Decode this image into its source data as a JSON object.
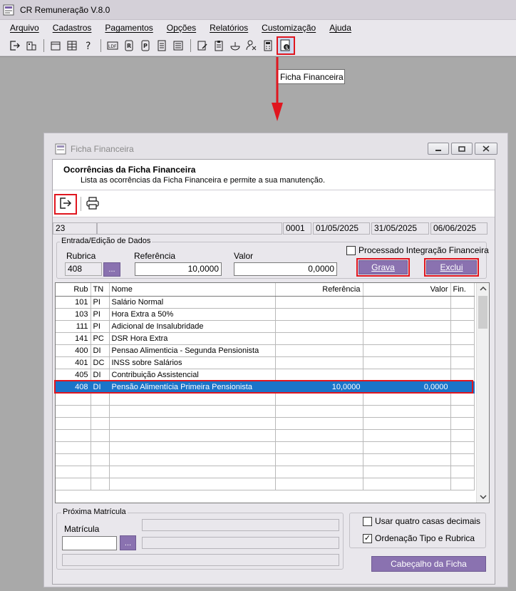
{
  "app": {
    "title": "CR Remuneração V.8.0"
  },
  "menu": [
    {
      "label": "Arquivo"
    },
    {
      "label": "Cadastros"
    },
    {
      "label": "Pagamentos"
    },
    {
      "label": "Opções"
    },
    {
      "label": "Relatórios"
    },
    {
      "label": "Customização"
    },
    {
      "label": "Ajuda"
    }
  ],
  "tooltip": "Ficha Financeira",
  "child": {
    "title": "Ficha Financeira",
    "header_title": "Ocorrências da Ficha Financeira",
    "header_desc": "Lista as ocorrências da Ficha Financeira e permite a sua manutenção."
  },
  "info": {
    "code": "23",
    "name": "",
    "seq": "0001",
    "date_start": "01/05/2025",
    "date_end": "31/05/2025",
    "date_pay": "06/06/2025"
  },
  "entry": {
    "group_label": "Entrada/Edição de Dados",
    "rubrica_label": "Rubrica",
    "rubrica_value": "408",
    "referencia_label": "Referência",
    "referencia_value": "10,0000",
    "valor_label": "Valor",
    "valor_value": "0,0000",
    "processado_label": "Processado Integração Financeira",
    "grava_label": "Grava",
    "exclui_label": "Exclui",
    "lookup_label": "..."
  },
  "grid": {
    "headers": {
      "rub": "Rub",
      "tn": "TN",
      "nome": "Nome",
      "referencia": "Referência",
      "valor": "Valor",
      "fin": "Fin."
    },
    "rows": [
      {
        "rub": "101",
        "tn": "PI",
        "nome": "Salário Normal",
        "referencia": "",
        "valor": "",
        "fin": ""
      },
      {
        "rub": "103",
        "tn": "PI",
        "nome": "Hora Extra a 50%",
        "referencia": "",
        "valor": "",
        "fin": ""
      },
      {
        "rub": "111",
        "tn": "PI",
        "nome": "Adicional de Insalubridade",
        "referencia": "",
        "valor": "",
        "fin": ""
      },
      {
        "rub": "141",
        "tn": "PC",
        "nome": "DSR Hora Extra",
        "referencia": "",
        "valor": "",
        "fin": ""
      },
      {
        "rub": "400",
        "tn": "DI",
        "nome": "Pensao Alimenticia - Segunda Pensionista",
        "referencia": "",
        "valor": "",
        "fin": ""
      },
      {
        "rub": "401",
        "tn": "DC",
        "nome": "INSS sobre Salários",
        "referencia": "",
        "valor": "",
        "fin": ""
      },
      {
        "rub": "405",
        "tn": "DI",
        "nome": "Contribuição Assistencial",
        "referencia": "",
        "valor": "",
        "fin": ""
      },
      {
        "rub": "408",
        "tn": "DI",
        "nome": "Pensão Alimentícia Primeira Pensionista",
        "referencia": "10,0000",
        "valor": "0,0000",
        "fin": ""
      }
    ],
    "selected_index": 7
  },
  "footer": {
    "proxima_label": "Próxima Matrícula",
    "matricula_label": "Matrícula",
    "matricula_value": "",
    "lookup_label": "...",
    "quatro_casas_label": "Usar quatro casas decimais",
    "quatro_casas_checked": false,
    "ordenacao_label": "Ordenação Tipo e Rubrica",
    "ordenacao_checked": true,
    "cabecalho_label": "Cabeçalho da Ficha"
  }
}
